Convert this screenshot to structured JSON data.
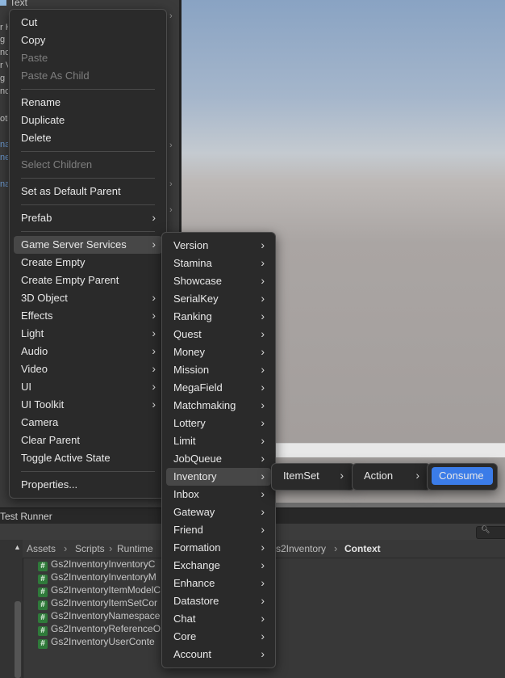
{
  "hierarchy": {
    "top_label": "Text",
    "fragments": [
      "r H",
      "g",
      "nc",
      "r V",
      "g",
      "nc",
      "oti",
      "na",
      "ne",
      "na"
    ]
  },
  "test_runner_label": "Test Runner",
  "breadcrumb": {
    "items": [
      "Assets",
      "Scripts",
      "Runtime"
    ],
    "tail": "s2Inventory",
    "current": "Context"
  },
  "files": [
    "Gs2InventoryInventoryC",
    "Gs2InventoryInventoryM",
    "Gs2InventoryItemModelC",
    "Gs2InventoryItemSetCor",
    "Gs2InventoryNamespace",
    "Gs2InventoryReferenceO",
    "Gs2InventoryUserConte"
  ],
  "context_menu": [
    {
      "label": "Cut"
    },
    {
      "label": "Copy"
    },
    {
      "label": "Paste",
      "disabled": true
    },
    {
      "label": "Paste As Child",
      "disabled": true
    },
    {
      "sep": true
    },
    {
      "label": "Rename"
    },
    {
      "label": "Duplicate"
    },
    {
      "label": "Delete"
    },
    {
      "sep": true
    },
    {
      "label": "Select Children",
      "disabled": true
    },
    {
      "sep": true
    },
    {
      "label": "Set as Default Parent"
    },
    {
      "sep": true
    },
    {
      "label": "Prefab",
      "submenu": true
    },
    {
      "sep": true
    },
    {
      "label": "Game Server Services",
      "submenu": true,
      "highlighted": true
    },
    {
      "label": "Create Empty"
    },
    {
      "label": "Create Empty Parent"
    },
    {
      "label": "3D Object",
      "submenu": true
    },
    {
      "label": "Effects",
      "submenu": true
    },
    {
      "label": "Light",
      "submenu": true
    },
    {
      "label": "Audio",
      "submenu": true
    },
    {
      "label": "Video",
      "submenu": true
    },
    {
      "label": "UI",
      "submenu": true
    },
    {
      "label": "UI Toolkit",
      "submenu": true
    },
    {
      "label": "Camera"
    },
    {
      "label": "Clear Parent"
    },
    {
      "label": "Toggle Active State"
    },
    {
      "sep": true
    },
    {
      "label": "Properties..."
    }
  ],
  "services_menu": [
    "Version",
    "Stamina",
    "Showcase",
    "SerialKey",
    "Ranking",
    "Quest",
    "Money",
    "Mission",
    "MegaField",
    "Matchmaking",
    "Lottery",
    "Limit",
    "JobQueue",
    "Inventory",
    "Inbox",
    "Gateway",
    "Friend",
    "Formation",
    "Exchange",
    "Enhance",
    "Datastore",
    "Chat",
    "Core",
    "Account"
  ],
  "services_highlighted": "Inventory",
  "inventory_menu": [
    {
      "label": "ItemSet",
      "submenu": true
    }
  ],
  "itemset_menu": [
    {
      "label": "Action",
      "submenu": true
    }
  ],
  "action_menu": [
    {
      "label": "Consume",
      "selected": true
    }
  ],
  "colors": {
    "menu_bg": "#2a2a2a",
    "highlight": "#474747",
    "selected": "#3b7ce8",
    "script_icon": "#2f7a3a"
  },
  "icons": {
    "submenu_arrow": "chevron-right-icon",
    "script": "csharp-script-icon",
    "search": "search-icon"
  }
}
